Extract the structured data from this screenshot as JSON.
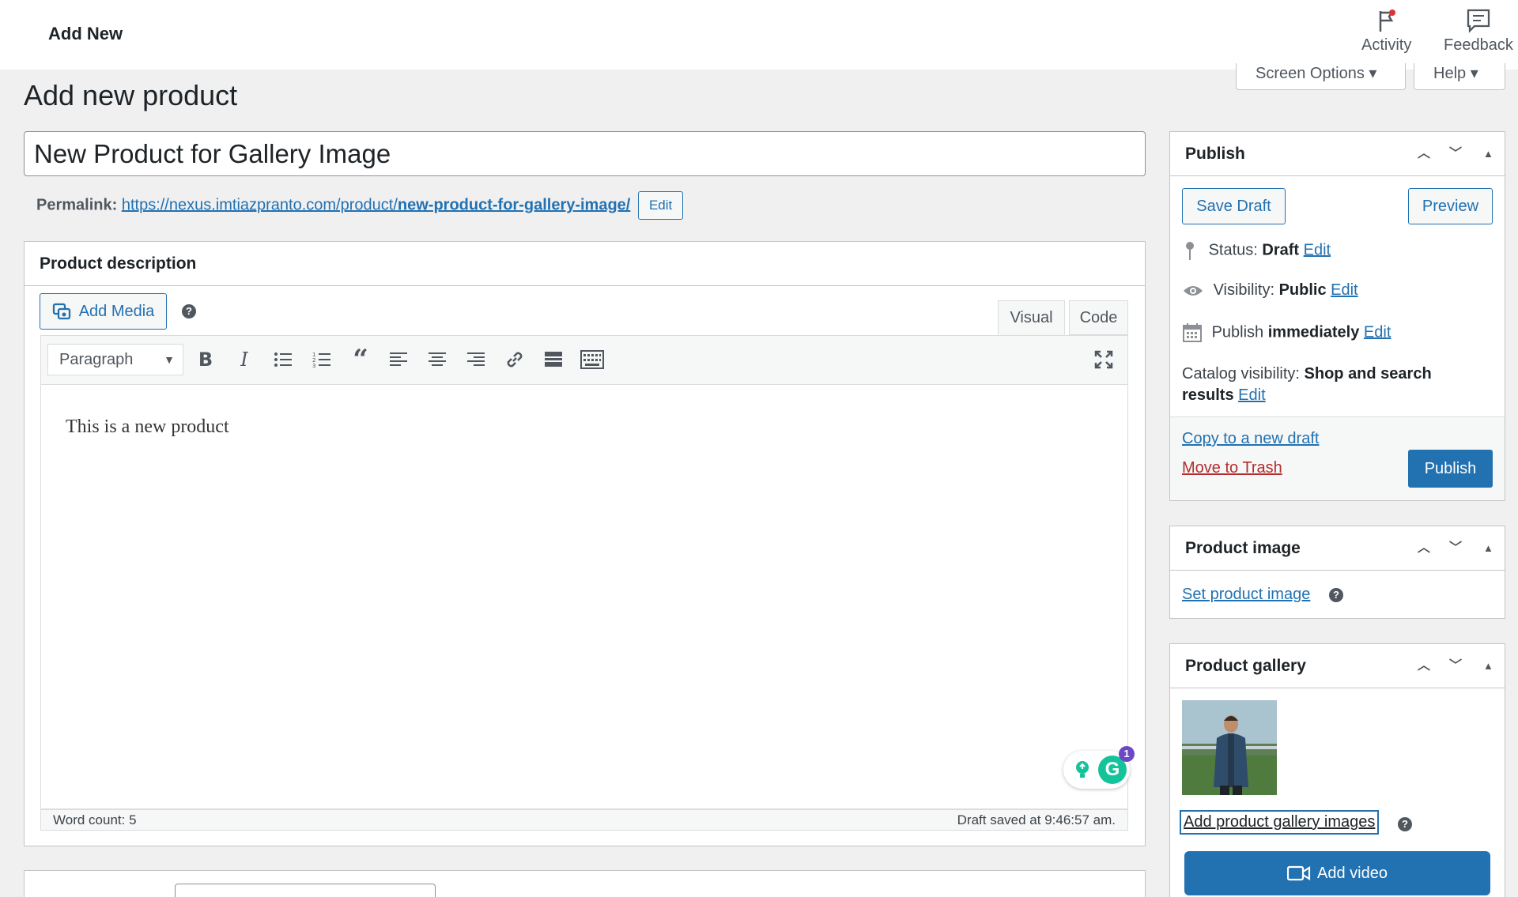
{
  "topbar": {
    "breadcrumb": "Add New",
    "activity_label": "Activity",
    "feedback_label": "Feedback"
  },
  "screen_options_label": "Screen Options ▾",
  "help_label": "Help ▾",
  "page_title": "Add new product",
  "title_value": "New Product for Gallery Image",
  "permalink": {
    "label": "Permalink:",
    "url_base": "https://nexus.imtiazpranto.com/product/",
    "url_slug": "new-product-for-gallery-image/",
    "edit_label": "Edit"
  },
  "description": {
    "heading": "Product description",
    "add_media_label": "Add Media",
    "tab_visual": "Visual",
    "tab_code": "Code",
    "format_value": "Paragraph",
    "content": "This is a new product",
    "word_count": "Word count: 5",
    "draft_saved": "Draft saved at 9:46:57 am.",
    "grammarly_badge": "1"
  },
  "publish": {
    "heading": "Publish",
    "save_draft_label": "Save Draft",
    "preview_label": "Preview",
    "status_label": "Status:",
    "status_value": "Draft",
    "visibility_label": "Visibility:",
    "visibility_value": "Public",
    "publish_label": "Publish",
    "publish_value": "immediately",
    "catalog_label": "Catalog visibility:",
    "catalog_value_1": "Shop and search",
    "catalog_value_2": "results",
    "edit_label": "Edit",
    "copy_draft_label": "Copy to a new draft",
    "trash_label": "Move to Trash",
    "publish_button_label": "Publish"
  },
  "product_image": {
    "heading": "Product image",
    "set_label": "Set product image"
  },
  "product_gallery": {
    "heading": "Product gallery",
    "add_label": "Add product gallery images",
    "add_video_label": "Add video"
  },
  "colors": {
    "accent": "#2271b1",
    "danger": "#b32d2e",
    "grammarly": "#15c39a"
  }
}
